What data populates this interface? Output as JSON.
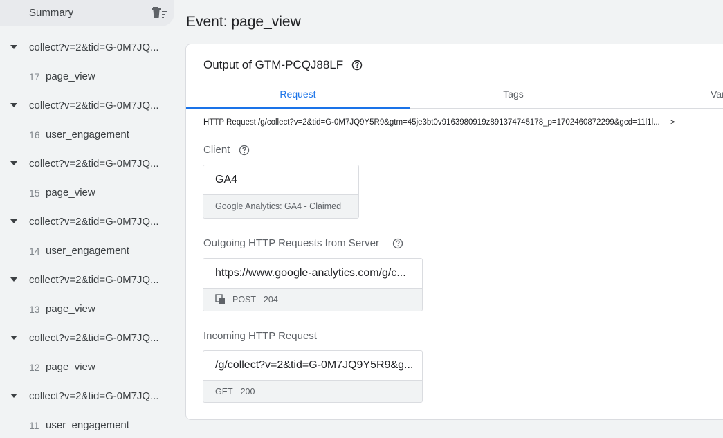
{
  "sidebar": {
    "summary_label": "Summary",
    "requests": [
      {
        "label": "collect?v=2&tid=G-0M7JQ...",
        "event_num": "17",
        "event_name": "page_view"
      },
      {
        "label": "collect?v=2&tid=G-0M7JQ...",
        "event_num": "16",
        "event_name": "user_engagement"
      },
      {
        "label": "collect?v=2&tid=G-0M7JQ...",
        "event_num": "15",
        "event_name": "page_view"
      },
      {
        "label": "collect?v=2&tid=G-0M7JQ...",
        "event_num": "14",
        "event_name": "user_engagement"
      },
      {
        "label": "collect?v=2&tid=G-0M7JQ...",
        "event_num": "13",
        "event_name": "page_view"
      },
      {
        "label": "collect?v=2&tid=G-0M7JQ...",
        "event_num": "12",
        "event_name": "page_view"
      },
      {
        "label": "collect?v=2&tid=G-0M7JQ...",
        "event_num": "11",
        "event_name": "user_engagement"
      }
    ]
  },
  "main": {
    "title": "Event: page_view",
    "card_title": "Output of GTM-PCQJ88LF",
    "tabs": [
      {
        "label": "Request"
      },
      {
        "label": "Tags"
      },
      {
        "label": "Var"
      }
    ],
    "http_request_line": "HTTP Request /g/collect?v=2&tid=G-0M7JQ9Y5R9&gtm=45je3bt0v9163980919z891374745178_p=1702460872299&gcd=11l1l...",
    "http_request_arrow": ">",
    "client": {
      "label": "Client",
      "name": "GA4",
      "status": "Google Analytics: GA4 - Claimed"
    },
    "outgoing": {
      "label": "Outgoing HTTP Requests from Server",
      "url": "https://www.google-analytics.com/g/c...",
      "status": "POST - 204"
    },
    "incoming": {
      "label": "Incoming HTTP Request",
      "url": "/g/collect?v=2&tid=G-0M7JQ9Y5R9&g...",
      "status": "GET - 200"
    }
  },
  "colors": {
    "accent": "#1a73e8",
    "sidebar_bg": "#f1f3f4",
    "card_bg": "#ffffff"
  },
  "icons": [
    "clear-all-icon",
    "caret-down-icon",
    "help-icon",
    "copy-icon"
  ]
}
